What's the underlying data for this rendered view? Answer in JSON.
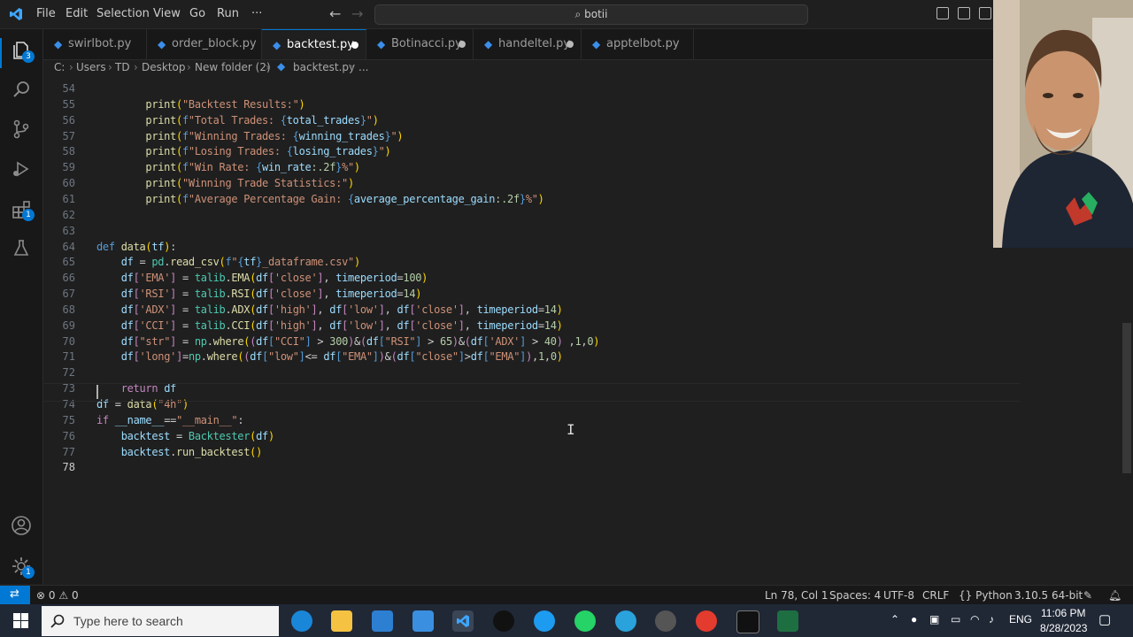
{
  "titlebar": {
    "menu": [
      "File",
      "Edit",
      "Selection",
      "View",
      "Go",
      "Run",
      "···"
    ],
    "search": "botii"
  },
  "activity": {
    "explorer_badge": "3",
    "extensions_badge": "1",
    "settings_badge": "1"
  },
  "tabs": [
    {
      "label": "swirlbot.py",
      "dirty": false,
      "active": false
    },
    {
      "label": "order_block.py",
      "dirty": false,
      "active": false
    },
    {
      "label": "backtest.py",
      "dirty": true,
      "active": true
    },
    {
      "label": "Botinacci.py",
      "dirty": true,
      "active": false
    },
    {
      "label": "handeltel.py",
      "dirty": true,
      "active": false
    },
    {
      "label": "apptelbot.py",
      "dirty": false,
      "active": false
    }
  ],
  "breadcrumb": [
    "C:",
    "Users",
    "TD",
    "Desktop",
    "New folder (2)",
    "backtest.py",
    "..."
  ],
  "code_lines": [
    {
      "n": "54",
      "html": ""
    },
    {
      "n": "55",
      "html": "        <span class=\"f\">print</span><span class=\"b\">(</span><span class=\"s\">\"Backtest Results:\"</span><span class=\"b\">)</span>"
    },
    {
      "n": "56",
      "html": "        <span class=\"f\">print</span><span class=\"b\">(</span><span class=\"fs\">f</span><span class=\"s\">\"Total Trades: </span><span class=\"fs\">{</span><span class=\"v\">total_trades</span><span class=\"fs\">}</span><span class=\"s\">\"</span><span class=\"b\">)</span>"
    },
    {
      "n": "57",
      "html": "        <span class=\"f\">print</span><span class=\"b\">(</span><span class=\"fs\">f</span><span class=\"s\">\"Winning Trades: </span><span class=\"fs\">{</span><span class=\"v\">winning_trades</span><span class=\"fs\">}</span><span class=\"s\">\"</span><span class=\"b\">)</span>"
    },
    {
      "n": "58",
      "html": "        <span class=\"f\">print</span><span class=\"b\">(</span><span class=\"fs\">f</span><span class=\"s\">\"Losing Trades: </span><span class=\"fs\">{</span><span class=\"v\">losing_trades</span><span class=\"fs\">}</span><span class=\"s\">\"</span><span class=\"b\">)</span>"
    },
    {
      "n": "59",
      "html": "        <span class=\"f\">print</span><span class=\"b\">(</span><span class=\"fs\">f</span><span class=\"s\">\"Win Rate: </span><span class=\"fs\">{</span><span class=\"v\">win_rate</span><span class=\"n\">:.2f</span><span class=\"fs\">}</span><span class=\"s\">%\"</span><span class=\"b\">)</span>"
    },
    {
      "n": "60",
      "html": "        <span class=\"f\">print</span><span class=\"b\">(</span><span class=\"s\">\"Winning Trade Statistics:\"</span><span class=\"b\">)</span>"
    },
    {
      "n": "61",
      "html": "        <span class=\"f\">print</span><span class=\"b\">(</span><span class=\"fs\">f</span><span class=\"s\">\"Average Percentage Gain: </span><span class=\"fs\">{</span><span class=\"v\">average_percentage_gain</span><span class=\"n\">:.2f</span><span class=\"fs\">}</span><span class=\"s\">%\"</span><span class=\"b\">)</span>"
    },
    {
      "n": "62",
      "html": ""
    },
    {
      "n": "63",
      "html": ""
    },
    {
      "n": "64",
      "html": "<span class=\"k\">def</span> <span class=\"f\">data</span><span class=\"b\">(</span><span class=\"v\">tf</span><span class=\"b\">)</span>:"
    },
    {
      "n": "65",
      "html": "    <span class=\"v\">df</span> = <span class=\"c\">pd</span>.<span class=\"f\">read_csv</span><span class=\"b\">(</span><span class=\"fs\">f</span><span class=\"s\">\"</span><span class=\"fs\">{</span><span class=\"v\">tf</span><span class=\"fs\">}</span><span class=\"s\">_dataframe.csv\"</span><span class=\"b\">)</span>"
    },
    {
      "n": "66",
      "html": "    <span class=\"v\">df</span><span class=\"kc\">[</span><span class=\"s\">'EMA'</span><span class=\"kc\">]</span> = <span class=\"c\">talib</span>.<span class=\"f\">EMA</span><span class=\"b\">(</span><span class=\"v\">df</span><span class=\"kc\">[</span><span class=\"s\">'close'</span><span class=\"kc\">]</span>, <span class=\"v\">timeperiod</span>=<span class=\"n\">100</span><span class=\"b\">)</span>"
    },
    {
      "n": "67",
      "html": "    <span class=\"v\">df</span><span class=\"kc\">[</span><span class=\"s\">'RSI'</span><span class=\"kc\">]</span> = <span class=\"c\">talib</span>.<span class=\"f\">RSI</span><span class=\"b\">(</span><span class=\"v\">df</span><span class=\"kc\">[</span><span class=\"s\">'close'</span><span class=\"kc\">]</span>, <span class=\"v\">timeperiod</span>=<span class=\"n\">14</span><span class=\"b\">)</span>"
    },
    {
      "n": "68",
      "html": "    <span class=\"v\">df</span><span class=\"kc\">[</span><span class=\"s\">'ADX'</span><span class=\"kc\">]</span> = <span class=\"c\">talib</span>.<span class=\"f\">ADX</span><span class=\"b\">(</span><span class=\"v\">df</span><span class=\"kc\">[</span><span class=\"s\">'high'</span><span class=\"kc\">]</span>, <span class=\"v\">df</span><span class=\"kc\">[</span><span class=\"s\">'low'</span><span class=\"kc\">]</span>, <span class=\"v\">df</span><span class=\"kc\">[</span><span class=\"s\">'close'</span><span class=\"kc\">]</span>, <span class=\"v\">timeperiod</span>=<span class=\"n\">14</span><span class=\"b\">)</span>"
    },
    {
      "n": "69",
      "html": "    <span class=\"v\">df</span><span class=\"kc\">[</span><span class=\"s\">'CCI'</span><span class=\"kc\">]</span> = <span class=\"c\">talib</span>.<span class=\"f\">CCI</span><span class=\"b\">(</span><span class=\"v\">df</span><span class=\"kc\">[</span><span class=\"s\">'high'</span><span class=\"kc\">]</span>, <span class=\"v\">df</span><span class=\"kc\">[</span><span class=\"s\">'low'</span><span class=\"kc\">]</span>, <span class=\"v\">df</span><span class=\"kc\">[</span><span class=\"s\">'close'</span><span class=\"kc\">]</span>, <span class=\"v\">timeperiod</span>=<span class=\"n\">14</span><span class=\"b\">)</span>"
    },
    {
      "n": "70",
      "html": "    <span class=\"v\">df</span><span class=\"kc\">[</span><span class=\"s\">\"str\"</span><span class=\"kc\">]</span> = <span class=\"c\">np</span>.<span class=\"f\">where</span><span class=\"b\">(</span><span class=\"kc\">(</span><span class=\"v\">df</span><span class=\"k\">[</span><span class=\"s\">\"CCI\"</span><span class=\"k\">]</span> &gt; <span class=\"n\">300</span><span class=\"kc\">)</span>&amp;<span class=\"kc\">(</span><span class=\"v\">df</span><span class=\"k\">[</span><span class=\"s\">\"RSI\"</span><span class=\"k\">]</span> &gt; <span class=\"n\">65</span><span class=\"kc\">)</span>&amp;<span class=\"kc\">(</span><span class=\"v\">df</span><span class=\"k\">[</span><span class=\"s\">'ADX'</span><span class=\"k\">]</span> &gt; <span class=\"n\">40</span><span class=\"kc\">)</span> ,<span class=\"n\">1</span>,<span class=\"n\">0</span><span class=\"b\">)</span>"
    },
    {
      "n": "71",
      "html": "    <span class=\"v\">df</span><span class=\"kc\">[</span><span class=\"s\">'long'</span><span class=\"kc\">]</span>=<span class=\"c\">np</span>.<span class=\"f\">where</span><span class=\"b\">(</span><span class=\"kc\">(</span><span class=\"v\">df</span><span class=\"k\">[</span><span class=\"s\">\"low\"</span><span class=\"k\">]</span>&lt;= <span class=\"v\">df</span><span class=\"k\">[</span><span class=\"s\">\"EMA\"</span><span class=\"k\">]</span><span class=\"kc\">)</span>&amp;<span class=\"kc\">(</span><span class=\"v\">df</span><span class=\"k\">[</span><span class=\"s\">\"close\"</span><span class=\"k\">]</span>&gt;<span class=\"v\">df</span><span class=\"k\">[</span><span class=\"s\">\"EMA\"</span><span class=\"k\">]</span><span class=\"kc\">)</span>,<span class=\"n\">1</span>,<span class=\"n\">0</span><span class=\"b\">)</span>"
    },
    {
      "n": "72",
      "html": ""
    },
    {
      "n": "73",
      "html": "    <span class=\"kc\">return</span> <span class=\"v\">df</span>"
    },
    {
      "n": "74",
      "html": "<span class=\"v\">df</span> = <span class=\"f\">data</span><span class=\"b\">(</span><span class=\"s\">\"4h\"</span><span class=\"b\">)</span>"
    },
    {
      "n": "75",
      "html": "<span class=\"kc\">if</span> <span class=\"v\">__name__</span>==<span class=\"s\">\"__main__\"</span>:"
    },
    {
      "n": "76",
      "html": "    <span class=\"v\">backtest</span> = <span class=\"c\">Backtester</span><span class=\"b\">(</span><span class=\"v\">df</span><span class=\"b\">)</span>"
    },
    {
      "n": "77",
      "html": "    <span class=\"v\">backtest</span>.<span class=\"f\">run_backtest</span><span class=\"b\">()</span>"
    },
    {
      "n": "78",
      "html": ""
    }
  ],
  "status": {
    "errors": "0",
    "warnings": "0",
    "position": "Ln 78, Col 1",
    "spaces": "Spaces: 4",
    "encoding": "UTF-8",
    "eol": "CRLF",
    "language": "Python",
    "interpreter": "3.10.5 64-bit"
  },
  "taskbar": {
    "search_placeholder": "Type here to search",
    "lang": "ENG",
    "time": "11:06 PM",
    "date": "8/28/2023"
  }
}
